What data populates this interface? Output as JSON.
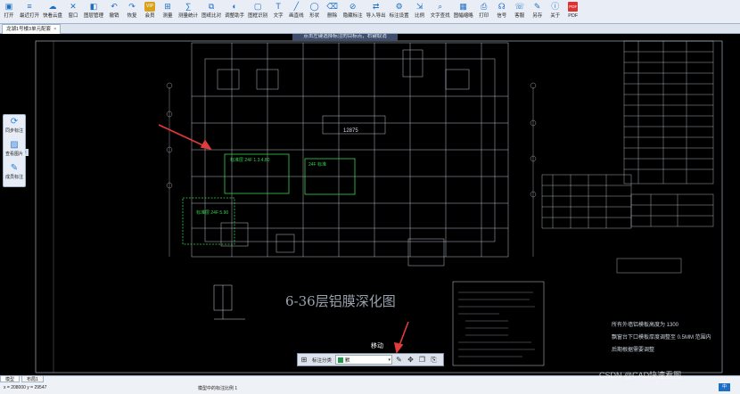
{
  "toolbar": {
    "items": [
      {
        "label": "打开",
        "icon": "open-folder-icon",
        "glyph": "▣"
      },
      {
        "label": "最近打开",
        "icon": "recent-files-icon",
        "glyph": "≡"
      },
      {
        "label": "快看云盘",
        "icon": "cloud-drive-icon",
        "glyph": "☁"
      },
      {
        "label": "窗口",
        "icon": "window-icon",
        "glyph": "✕"
      },
      {
        "label": "图层管理",
        "icon": "layer-management-icon",
        "glyph": "◧"
      },
      {
        "label": "撤销",
        "icon": "undo-icon",
        "glyph": "↶"
      },
      {
        "label": "恢复",
        "icon": "redo-icon",
        "glyph": "↷"
      },
      {
        "label": "会员",
        "icon": "vip-icon",
        "glyph": "VIP",
        "vip": true
      },
      {
        "label": "测量",
        "icon": "measure-icon",
        "glyph": "⊞"
      },
      {
        "label": "测量统计",
        "icon": "measure-stats-icon",
        "glyph": "∑"
      },
      {
        "label": "图纸比对",
        "icon": "drawing-compare-icon",
        "glyph": "⧉"
      },
      {
        "label": "调整助手",
        "icon": "adjust-assistant-icon",
        "glyph": "◐"
      },
      {
        "label": "图框识别",
        "icon": "frame-recognize-icon",
        "glyph": "▢"
      },
      {
        "label": "文字",
        "icon": "text-icon",
        "glyph": "T"
      },
      {
        "label": "画直线",
        "icon": "line-icon",
        "glyph": "╱"
      },
      {
        "label": "形状",
        "icon": "shape-icon",
        "glyph": "◯"
      },
      {
        "label": "删除",
        "icon": "delete-icon",
        "glyph": "⌫"
      },
      {
        "label": "隐藏标注",
        "icon": "hide-annotation-icon",
        "glyph": "⊘"
      },
      {
        "label": "导入导出",
        "icon": "import-export-icon",
        "glyph": "⇄"
      },
      {
        "label": "标注设置",
        "icon": "annotation-settings-icon",
        "glyph": "⚙"
      },
      {
        "label": "比例",
        "icon": "scale-icon",
        "glyph": "⇲"
      },
      {
        "label": "文字查找",
        "icon": "text-search-icon",
        "glyph": "⌕"
      },
      {
        "label": "图幅缩略",
        "icon": "thumbnail-icon",
        "glyph": "▦"
      },
      {
        "label": "打印",
        "icon": "print-icon",
        "glyph": "⎙"
      },
      {
        "label": "信号",
        "icon": "signal-icon",
        "glyph": "☊"
      },
      {
        "label": "客服",
        "icon": "customer-service-icon",
        "glyph": "☏"
      },
      {
        "label": "另存",
        "icon": "save-as-icon",
        "glyph": "✎"
      },
      {
        "label": "关于",
        "icon": "about-icon",
        "glyph": "ⓘ"
      },
      {
        "label": "PDF",
        "icon": "pdf-icon",
        "glyph": "PDF",
        "pdf": true
      }
    ]
  },
  "tab": {
    "title": "龙湖1号楼3单元配套",
    "close": "×"
  },
  "tooltip": "点击左键选择标注的目标点，右键取消",
  "side_panel": {
    "items": [
      {
        "label": "同步标注",
        "icon": "sync-annotation-icon",
        "glyph": "⟳"
      },
      {
        "label": "查看图片",
        "icon": "view-image-icon",
        "glyph": "▨"
      },
      {
        "label": "成员标注",
        "icon": "member-annotation-icon",
        "glyph": "✎"
      }
    ],
    "toggle": "‹"
  },
  "float_toolbar": {
    "grid_icon": "⊞",
    "label": "标注分类",
    "selected": "默",
    "dropdown_arrow": "▾",
    "actions": [
      {
        "icon": "edit-icon",
        "glyph": "✎"
      },
      {
        "icon": "move-icon",
        "glyph": "✥"
      },
      {
        "icon": "copy-icon",
        "glyph": "❐"
      },
      {
        "icon": "paste-icon",
        "glyph": "⎘"
      }
    ]
  },
  "move_label": "移动",
  "drawing": {
    "title": "6-36层铝膜深化图",
    "dim_label": "12875",
    "box1_label": "标准层 24F 1.3.4.80",
    "box2_label": "24F 标准",
    "box3_label": "标准层 24F 5.90",
    "right_note1": "所有外墙铝模板高度为 1300",
    "right_note2": "飘窗台下口模板厚度调整至 0.5MM 范围内",
    "right_note3": "后期根据需要调整"
  },
  "layouts": [
    "模型",
    "布局1"
  ],
  "status": {
    "coords": "x = 208000  y = 29547",
    "scale_text": "模型中的标注比例 1",
    "badge": "中"
  },
  "watermark": "CSDN @CAD快速看图"
}
